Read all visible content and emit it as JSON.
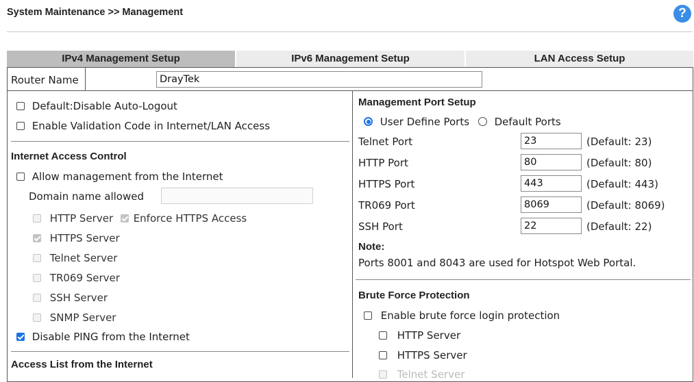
{
  "breadcrumb": "System Maintenance >> Management",
  "help_icon": "?",
  "tabs": [
    {
      "label": "IPv4 Management Setup",
      "active": true
    },
    {
      "label": "IPv6 Management Setup",
      "active": false
    },
    {
      "label": "LAN Access Setup",
      "active": false
    }
  ],
  "router_name": {
    "label": "Router Name",
    "value": "DrayTek"
  },
  "left": {
    "auto_logout": {
      "label": "Default:Disable Auto-Logout",
      "checked": false
    },
    "validation_code": {
      "label": "Enable Validation Code in Internet/LAN Access",
      "checked": false
    },
    "internet_access_control": {
      "heading": "Internet Access Control",
      "allow_mgmt": {
        "label": "Allow management from the Internet",
        "checked": false
      },
      "domain_label": "Domain name allowed",
      "domain_value": "",
      "http_server": {
        "label": "HTTP Server",
        "checked": false,
        "disabled": true
      },
      "enforce_https": {
        "label": "Enforce HTTPS Access",
        "checked": true,
        "disabled": true
      },
      "https_server": {
        "label": "HTTPS Server",
        "checked": true,
        "disabled": true
      },
      "telnet_server": {
        "label": "Telnet Server",
        "checked": false,
        "disabled": true
      },
      "tr069_server": {
        "label": "TR069 Server",
        "checked": false,
        "disabled": true
      },
      "ssh_server": {
        "label": "SSH Server",
        "checked": false,
        "disabled": true
      },
      "snmp_server": {
        "label": "SNMP Server",
        "checked": false,
        "disabled": true
      },
      "disable_ping": {
        "label": "Disable PING from the Internet",
        "checked": true
      }
    },
    "access_list_heading": "Access List from the Internet"
  },
  "right": {
    "mgmt_port_heading": "Management Port Setup",
    "user_define_label": "User Define Ports",
    "default_ports_label": "Default Ports",
    "ports": [
      {
        "label": "Telnet Port",
        "value": "23",
        "default": "(Default: 23)"
      },
      {
        "label": "HTTP Port",
        "value": "80",
        "default": "(Default: 80)"
      },
      {
        "label": "HTTPS Port",
        "value": "443",
        "default": "(Default: 443)"
      },
      {
        "label": "TR069 Port",
        "value": "8069",
        "default": "(Default: 8069)"
      },
      {
        "label": "SSH Port",
        "value": "22",
        "default": "(Default: 22)"
      }
    ],
    "note_heading": "Note:",
    "note_text": "Ports 8001 and 8043 are used for Hotspot Web Portal.",
    "brute_force_heading": "Brute Force Protection",
    "brute_force_enable": {
      "label": "Enable brute force login protection",
      "checked": false
    },
    "bf_http": {
      "label": "HTTP Server",
      "checked": false
    },
    "bf_https": {
      "label": "HTTPS Server",
      "checked": false
    },
    "bf_telnet": {
      "label": "Telnet Server",
      "checked": false
    }
  },
  "colors": {
    "accent": "#1a73e8",
    "help": "#3a8ee6",
    "tab_active": "#bdbdbd",
    "tab_inactive": "#ececec"
  }
}
